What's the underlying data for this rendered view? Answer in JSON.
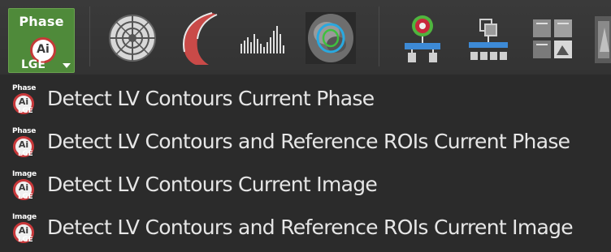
{
  "toolbar": {
    "main_button": {
      "top_text": "Phase",
      "logo_text": "Ai",
      "bottom_text": "LGE",
      "accent": "#4f8a3a",
      "logo_ring": "#c43a37"
    },
    "icons": [
      "bullseye-segment-icon",
      "myocardial-wall-icon",
      "histogram-icon",
      "cardiac-slice-contour-icon",
      "target-hierarchy-icon",
      "layered-hierarchy-icon",
      "image-grid-icon",
      "partial-image-icon"
    ]
  },
  "menu": {
    "items": [
      {
        "badge_top": "Phase",
        "badge_logo": "Ai",
        "badge_bottom": "LGE",
        "label": "Detect LV Contours Current Phase"
      },
      {
        "badge_top": "Phase",
        "badge_logo": "Ai",
        "badge_bottom": "LGE",
        "label": "Detect LV Contours and Reference ROIs Current Phase"
      },
      {
        "badge_top": "Image",
        "badge_logo": "Ai",
        "badge_bottom": "LGE",
        "label": "Detect LV Contours Current Image"
      },
      {
        "badge_top": "Image",
        "badge_logo": "Ai",
        "badge_bottom": "LGE",
        "label": "Detect LV Contours and Reference ROIs Current Image"
      }
    ]
  }
}
